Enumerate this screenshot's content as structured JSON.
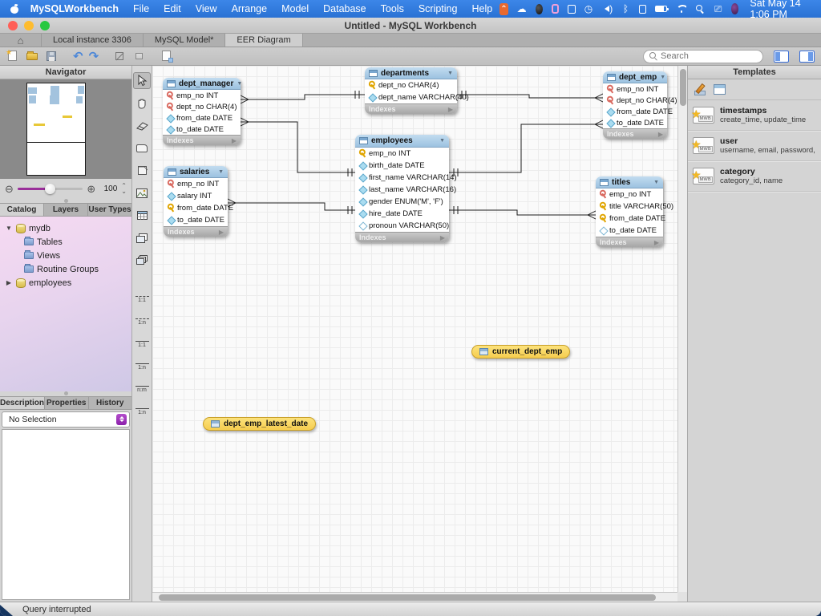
{
  "menu_bar": {
    "app_name": "MySQLWorkbench",
    "menus": [
      "File",
      "Edit",
      "View",
      "Arrange",
      "Model",
      "Database",
      "Tools",
      "Scripting",
      "Help"
    ],
    "clock": "Sat May 14 1:06 PM"
  },
  "window": {
    "title": "Untitled - MySQL Workbench"
  },
  "tab_bar": {
    "tabs": [
      {
        "label": "Local instance 3306"
      },
      {
        "label": "MySQL Model*"
      },
      {
        "label": "EER Diagram"
      }
    ]
  },
  "search": {
    "placeholder": "Search"
  },
  "navigator": {
    "title": "Navigator",
    "zoom_value": "100"
  },
  "sidebar_tabs": {
    "catalog": "Catalog",
    "layers": "Layers",
    "user_types": "User Types"
  },
  "catalog_tree": {
    "mydb": "mydb",
    "tables": "Tables",
    "views": "Views",
    "routine_groups": "Routine Groups",
    "employees": "employees"
  },
  "bottom_tabs": {
    "description": "Description",
    "properties": "Properties",
    "history": "History"
  },
  "selection": {
    "value": "No Selection"
  },
  "palette": {
    "rel_labels": [
      "1:1",
      "1:n",
      "1:1",
      "1:n",
      "n:m",
      "1:n"
    ]
  },
  "templates": {
    "title": "Templates",
    "items": [
      {
        "name": "timestamps",
        "fields": "create_time, update_time"
      },
      {
        "name": "user",
        "fields": "username, email, password, cre..."
      },
      {
        "name": "category",
        "fields": "category_id, name"
      }
    ]
  },
  "status_bar": {
    "message": "Query interrupted"
  },
  "diagram": {
    "tables": [
      {
        "name": "dept_manager",
        "footer": "Indexes",
        "columns": [
          {
            "icon": "pkfk",
            "text": "emp_no INT"
          },
          {
            "icon": "pkfk",
            "text": "dept_no CHAR(4)"
          },
          {
            "icon": "attr",
            "text": "from_date DATE"
          },
          {
            "icon": "attr",
            "text": "to_date DATE"
          }
        ]
      },
      {
        "name": "departments",
        "footer": "Indexes",
        "columns": [
          {
            "icon": "pk",
            "text": "dept_no CHAR(4)"
          },
          {
            "icon": "attr",
            "text": "dept_name VARCHAR(40)"
          }
        ]
      },
      {
        "name": "dept_emp",
        "footer": "Indexes",
        "columns": [
          {
            "icon": "pkfk",
            "text": "emp_no INT"
          },
          {
            "icon": "pkfk",
            "text": "dept_no CHAR(4)"
          },
          {
            "icon": "attr",
            "text": "from_date DATE"
          },
          {
            "icon": "attr",
            "text": "to_date DATE"
          }
        ]
      },
      {
        "name": "salaries",
        "footer": "Indexes",
        "columns": [
          {
            "icon": "pkfk",
            "text": "emp_no INT"
          },
          {
            "icon": "attr",
            "text": "salary INT"
          },
          {
            "icon": "pk",
            "text": "from_date DATE"
          },
          {
            "icon": "attr",
            "text": "to_date DATE"
          }
        ]
      },
      {
        "name": "employees",
        "footer": "Indexes",
        "columns": [
          {
            "icon": "pk",
            "text": "emp_no INT"
          },
          {
            "icon": "attr",
            "text": "birth_date DATE"
          },
          {
            "icon": "attr",
            "text": "first_name VARCHAR(14)"
          },
          {
            "icon": "attr",
            "text": "last_name VARCHAR(16)"
          },
          {
            "icon": "attr",
            "text": "gender ENUM('M', 'F')"
          },
          {
            "icon": "attr",
            "text": "hire_date DATE"
          },
          {
            "icon": "attrnull",
            "text": "pronoun VARCHAR(50)"
          }
        ]
      },
      {
        "name": "titles",
        "footer": "Indexes",
        "columns": [
          {
            "icon": "pkfk",
            "text": "emp_no INT"
          },
          {
            "icon": "pk",
            "text": "title VARCHAR(50)"
          },
          {
            "icon": "pk",
            "text": "from_date DATE"
          },
          {
            "icon": "attrnull",
            "text": "to_date DATE"
          }
        ]
      }
    ],
    "views": [
      {
        "name": "current_dept_emp"
      },
      {
        "name": "dept_emp_latest_date"
      }
    ],
    "relationships": [
      {
        "from": "dept_manager",
        "to": "departments"
      },
      {
        "from": "dept_emp",
        "to": "departments"
      },
      {
        "from": "dept_manager",
        "to": "employees"
      },
      {
        "from": "salaries",
        "to": "employees"
      },
      {
        "from": "dept_emp",
        "to": "employees"
      },
      {
        "from": "titles",
        "to": "employees"
      }
    ]
  }
}
